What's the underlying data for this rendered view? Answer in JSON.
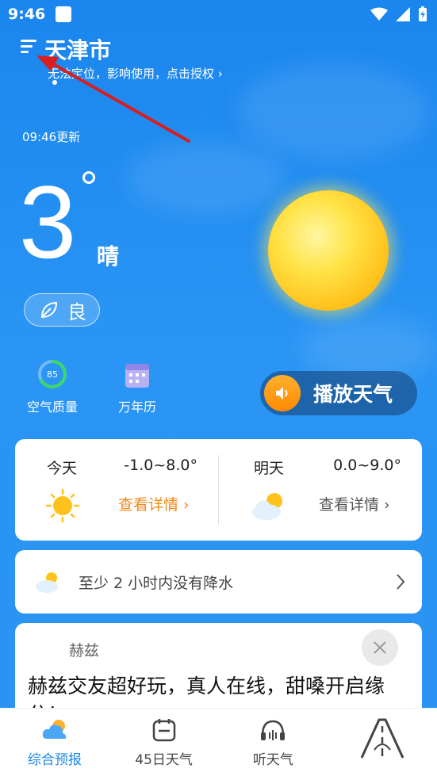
{
  "status_bar": {
    "time": "9:46"
  },
  "header": {
    "city": "天津市",
    "location_hint": "无法定位，影响使用，点击授权 ›"
  },
  "current": {
    "update_time": "09:46更新",
    "temperature": "3",
    "condition": "晴",
    "air_quality_label": "良"
  },
  "quick_actions": {
    "aqi_value": "85",
    "aqi_label": "空气质量",
    "calendar_label": "万年历",
    "play_label": "播放天气"
  },
  "forecast": {
    "today": {
      "day": "今天",
      "range": "-1.0~8.0°",
      "link": "查看详情 ›"
    },
    "tomorrow": {
      "day": "明天",
      "range": "0.0~9.0°",
      "link": "查看详情 ›"
    }
  },
  "rain_notice": {
    "text": "至少 2 小时内没有降水"
  },
  "ad": {
    "brand": "赫兹",
    "text": "赫兹交友超好玩，真人在线，甜嗓开启缘分！"
  },
  "nav": {
    "items": [
      {
        "label": "综合预报",
        "icon": "cloud-sun-icon"
      },
      {
        "label": "45日天气",
        "icon": "calendar-icon"
      },
      {
        "label": "听天气",
        "icon": "headphones-icon"
      },
      {
        "label": "",
        "icon": "road-icon"
      }
    ],
    "active": 0
  },
  "colors": {
    "accent": "#1e88e5",
    "link_orange": "#f08a1c",
    "sky": "#1f8df0"
  }
}
